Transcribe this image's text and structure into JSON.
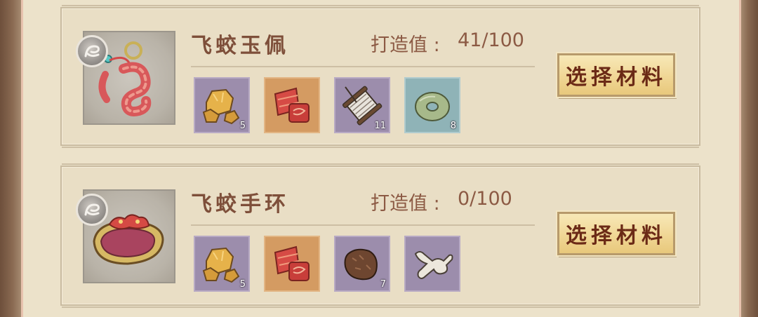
{
  "forge_label": "打造值 :",
  "recipes": [
    {
      "title": "飞蛟玉佩",
      "forge_value": "41/100",
      "button_label": "选择材料",
      "materials": [
        {
          "icon": "gold-ore-icon",
          "count": "5",
          "rarity": "purple"
        },
        {
          "icon": "red-silk-roll-icon",
          "count": "",
          "rarity": "orange"
        },
        {
          "icon": "thread-spool-icon",
          "count": "11",
          "rarity": "purple"
        },
        {
          "icon": "jade-disc-icon",
          "count": "8",
          "rarity": "blue"
        }
      ]
    },
    {
      "title": "飞蛟手环",
      "forge_value": "0/100",
      "button_label": "选择材料",
      "materials": [
        {
          "icon": "gold-ore-icon",
          "count": "5",
          "rarity": "purple"
        },
        {
          "icon": "red-silk-roll-icon",
          "count": "",
          "rarity": "orange"
        },
        {
          "icon": "fur-pelt-icon",
          "count": "7",
          "rarity": "purple"
        },
        {
          "icon": "bone-icon",
          "count": "",
          "rarity": "purple"
        }
      ]
    }
  ]
}
